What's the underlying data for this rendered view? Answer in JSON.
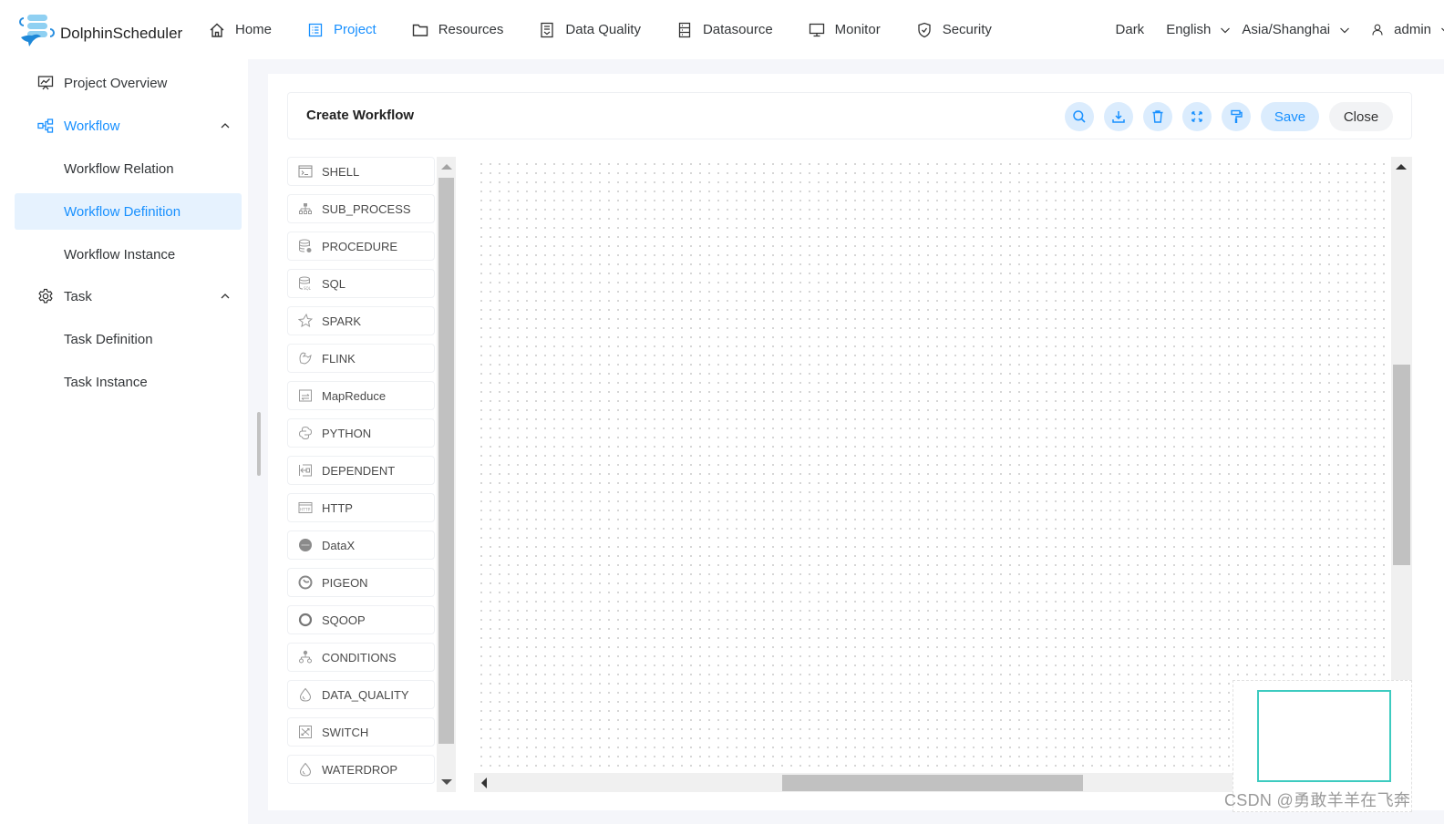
{
  "app": {
    "name": "DolphinScheduler",
    "brand_color": "#1890ff"
  },
  "topnav": {
    "items": [
      {
        "label": "Home",
        "icon": "home-icon",
        "active": false
      },
      {
        "label": "Project",
        "icon": "project-icon",
        "active": true
      },
      {
        "label": "Resources",
        "icon": "folder-icon",
        "active": false
      },
      {
        "label": "Data Quality",
        "icon": "data-quality-icon",
        "active": false
      },
      {
        "label": "Datasource",
        "icon": "datasource-icon",
        "active": false
      },
      {
        "label": "Monitor",
        "icon": "monitor-icon",
        "active": false
      },
      {
        "label": "Security",
        "icon": "shield-icon",
        "active": false
      }
    ],
    "theme_label": "Dark",
    "language": "English",
    "timezone": "Asia/Shanghai",
    "user": "admin"
  },
  "sidebar": {
    "items": [
      {
        "label": "Project Overview",
        "icon": "chart-board-icon",
        "type": "item"
      },
      {
        "label": "Workflow",
        "icon": "workflow-icon",
        "type": "group",
        "expanded": true
      },
      {
        "label": "Workflow Relation",
        "type": "sub"
      },
      {
        "label": "Workflow Definition",
        "type": "sub",
        "selected": true
      },
      {
        "label": "Workflow Instance",
        "type": "sub"
      },
      {
        "label": "Task",
        "icon": "gear-icon",
        "type": "group",
        "expanded": true
      },
      {
        "label": "Task Definition",
        "type": "sub"
      },
      {
        "label": "Task Instance",
        "type": "sub"
      }
    ]
  },
  "editor": {
    "title": "Create Workflow",
    "toolbar": {
      "search_icon": "search-icon",
      "download_icon": "download-icon",
      "delete_icon": "trash-icon",
      "fullscreen_icon": "fullscreen-icon",
      "format_icon": "paint-roller-icon",
      "save_label": "Save",
      "close_label": "Close"
    },
    "task_types": [
      {
        "label": "SHELL",
        "icon": "terminal-icon"
      },
      {
        "label": "SUB_PROCESS",
        "icon": "sitemap-icon"
      },
      {
        "label": "PROCEDURE",
        "icon": "database-gear-icon"
      },
      {
        "label": "SQL",
        "icon": "database-sql-icon"
      },
      {
        "label": "SPARK",
        "icon": "star-icon"
      },
      {
        "label": "FLINK",
        "icon": "squirrel-icon"
      },
      {
        "label": "MapReduce",
        "icon": "mapreduce-icon"
      },
      {
        "label": "PYTHON",
        "icon": "python-icon"
      },
      {
        "label": "DEPENDENT",
        "icon": "dependent-icon"
      },
      {
        "label": "HTTP",
        "icon": "http-icon"
      },
      {
        "label": "DataX",
        "icon": "datax-icon"
      },
      {
        "label": "PIGEON",
        "icon": "pigeon-icon"
      },
      {
        "label": "SQOOP",
        "icon": "sqoop-icon"
      },
      {
        "label": "CONDITIONS",
        "icon": "conditions-icon"
      },
      {
        "label": "DATA_QUALITY",
        "icon": "drop-icon"
      },
      {
        "label": "SWITCH",
        "icon": "switch-icon"
      },
      {
        "label": "WATERDROP",
        "icon": "drop-icon"
      }
    ],
    "minimap_color": "#3dcbc0"
  },
  "watermark": "CSDN @勇敢羊羊在飞奔"
}
